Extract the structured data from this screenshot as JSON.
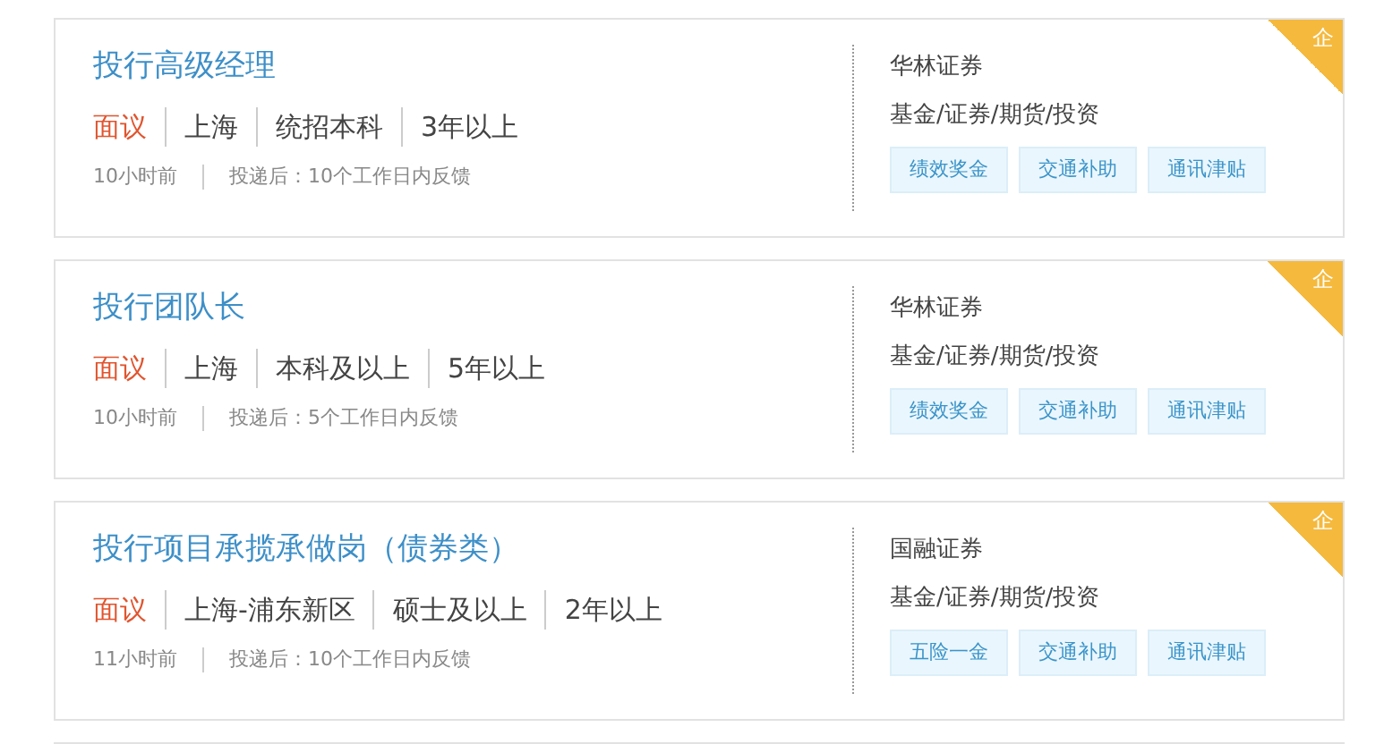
{
  "jobs": [
    {
      "title": "投行高级经理",
      "salary": "面议",
      "location": "上海",
      "education": "统招本科",
      "experience": "3年以上",
      "posted": "10小时前",
      "feedback": "投递后：10个工作日内反馈",
      "company": "华林证券",
      "industry": "基金/证券/期货/投资",
      "tags": [
        "绩效奖金",
        "交通补助",
        "通讯津贴"
      ],
      "badge": "企"
    },
    {
      "title": "投行团队长",
      "salary": "面议",
      "location": "上海",
      "education": "本科及以上",
      "experience": "5年以上",
      "posted": "10小时前",
      "feedback": "投递后：5个工作日内反馈",
      "company": "华林证券",
      "industry": "基金/证券/期货/投资",
      "tags": [
        "绩效奖金",
        "交通补助",
        "通讯津贴"
      ],
      "badge": "企"
    },
    {
      "title": "投行项目承揽承做岗（债券类）",
      "salary": "面议",
      "location": "上海-浦东新区",
      "education": "硕士及以上",
      "experience": "2年以上",
      "posted": "11小时前",
      "feedback": "投递后：10个工作日内反馈",
      "company": "国融证券",
      "industry": "基金/证券/期货/投资",
      "tags": [
        "五险一金",
        "交通补助",
        "通讯津贴"
      ],
      "badge": "企"
    }
  ]
}
